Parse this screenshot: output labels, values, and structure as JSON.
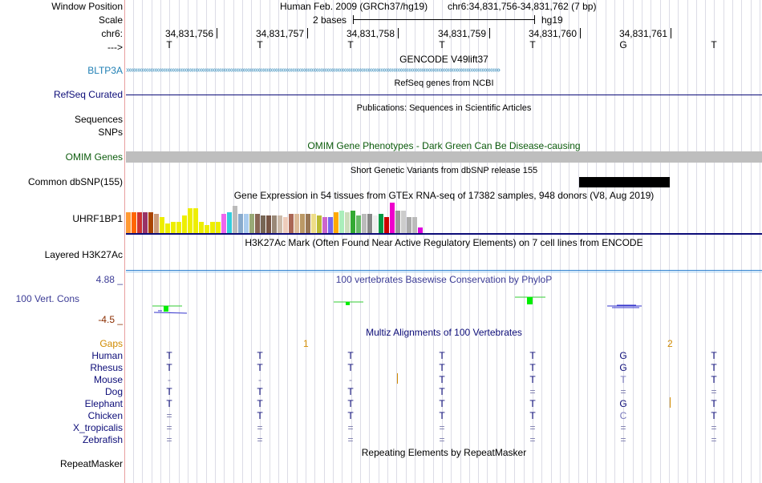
{
  "header": {
    "window_position_label": "Window Position",
    "scale_label": "Scale",
    "chrom_label": "chr6:",
    "strand_label": "--->",
    "assembly": "Human Feb. 2009 (GRCh37/hg19)",
    "position": "chr6:34,831,756-34,831,762 (7 bp)",
    "scale_text": "2 bases",
    "db": "hg19",
    "coords": [
      "34,831,756",
      "34,831,757",
      "34,831,758",
      "34,831,759",
      "34,831,760",
      "34,831,761"
    ],
    "bases": [
      "T",
      "T",
      "T",
      "T",
      "T",
      "G",
      "T"
    ]
  },
  "tracks": {
    "gencode": {
      "title": "GENCODE V49lift37",
      "gene": "BLTP3A",
      "color": "#1f7fb4"
    },
    "refseq": {
      "title": "RefSeq genes from NCBI",
      "label": "RefSeq Curated",
      "color": "#0c0c78"
    },
    "publications": {
      "title": "Publications: Sequences in Scientific Articles",
      "label1": "Sequences",
      "label2": "SNPs"
    },
    "omim": {
      "title": "OMIM Gene Phenotypes - Dark Green Can Be Disease-causing",
      "label": "OMIM Genes",
      "color": "#0d5c0d"
    },
    "dbsnp": {
      "title": "Short Genetic Variants from dbSNP release 155",
      "label": "Common dbSNP(155)"
    },
    "gtex": {
      "title": "Gene Expression in 54 tissues from GTEx RNA-seq of 17382 samples, 948 donors (V8, Aug 2019)",
      "gene": "UHRF1BP1",
      "values": [
        26,
        26,
        26,
        26,
        26,
        24,
        20,
        12,
        14,
        14,
        22,
        31,
        31,
        14,
        10,
        14,
        14,
        24,
        26,
        34,
        24,
        24,
        24,
        24,
        22,
        22,
        22,
        22,
        20,
        24,
        24,
        24,
        24,
        24,
        22,
        20,
        20,
        26,
        28,
        26,
        28,
        22,
        24,
        24,
        22,
        24,
        20,
        38,
        28,
        28,
        20,
        20,
        7
      ],
      "colors": [
        "#ff9933",
        "#ff6600",
        "#cc3333",
        "#993366",
        "#aa4400",
        "#cc9977",
        "#eeee00",
        "#eeee00",
        "#eeee00",
        "#eeee00",
        "#eeee00",
        "#eeee00",
        "#eeee00",
        "#eeee00",
        "#eeee00",
        "#eeee00",
        "#eeee00",
        "#ee66ee",
        "#33ccdd",
        "#bbbbbb",
        "#88aacc",
        "#aaccee",
        "#99aa77",
        "#886655",
        "#776655",
        "#775544",
        "#998877",
        "#ccbbaa",
        "#eeccbb",
        "#aa6655",
        "#ddbb99",
        "#bb9966",
        "#997755",
        "#eedd88",
        "#bbbb33",
        "#cc66cc",
        "#7766ee",
        "#ffaa00",
        "#aaeebb",
        "#ccddbb",
        "#33aa33",
        "#66bb66",
        "#bbbbbb",
        "#888888",
        "#eeeeee",
        "#009944",
        "#cc0000",
        "#ee00cc",
        "#999999",
        "#cccccc",
        "#aaaaaa",
        "#bbbbbb",
        "#dd00dd"
      ]
    },
    "h3k27ac": {
      "title": "H3K27Ac Mark (Often Found Near Active Regulatory Elements) on 7 cell lines from ENCODE",
      "label": "Layered H3K27Ac"
    },
    "cons": {
      "title": "100 vertebrates Basewise Conservation by PhyloP",
      "label": "100 Vert. Cons",
      "max": "4.88 _",
      "min": "-4.5 _",
      "color": "#3c3c96",
      "max_color": "#3c3c96",
      "min_color": "#8b2d00"
    },
    "multiz": {
      "title": "Multiz Alignments of 100 Vertebrates",
      "gaps_label": "Gaps",
      "gap1": "1",
      "gap2": "2",
      "species": [
        {
          "name": "Human",
          "bases": [
            "T",
            "T",
            "T",
            "T",
            "T",
            "G",
            "T"
          ]
        },
        {
          "name": "Rhesus",
          "bases": [
            "T",
            "T",
            "T",
            "T",
            "T",
            "G",
            "T"
          ]
        },
        {
          "name": "Mouse",
          "bases": [
            "-",
            "-",
            "-",
            "T",
            "T",
            "T",
            "T"
          ]
        },
        {
          "name": "Dog",
          "bases": [
            "T",
            "T",
            "T",
            "T",
            "=",
            "=",
            "="
          ]
        },
        {
          "name": "Elephant",
          "bases": [
            "T",
            "T",
            "T",
            "T",
            "T",
            "G",
            "T"
          ]
        },
        {
          "name": "Chicken",
          "bases": [
            "=",
            "T",
            "T",
            "T",
            "T",
            "C",
            "T"
          ]
        },
        {
          "name": "X_tropicalis",
          "bases": [
            "=",
            "=",
            "=",
            "=",
            "=",
            "=",
            "="
          ]
        },
        {
          "name": "Zebrafish",
          "bases": [
            "=",
            "=",
            "=",
            "=",
            "=",
            "=",
            "="
          ]
        }
      ]
    },
    "repeatmasker": {
      "title": "Repeating Elements by RepeatMasker",
      "label": "RepeatMasker"
    }
  }
}
